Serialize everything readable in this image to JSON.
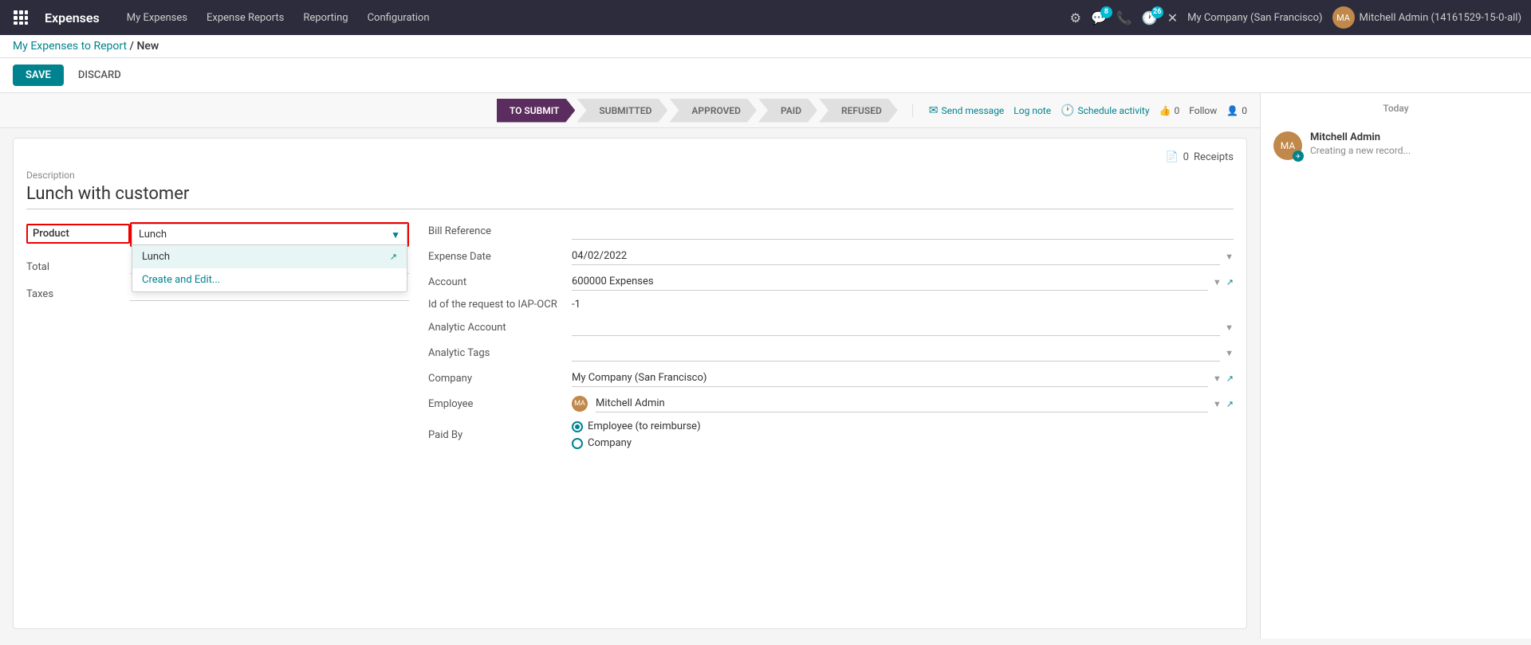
{
  "topnav": {
    "app_name": "Expenses",
    "menu_items": [
      "My Expenses",
      "Expense Reports",
      "Reporting",
      "Configuration"
    ],
    "company": "My Company (San Francisco)",
    "user": "Mitchell Admin (14161529-15-0-all)",
    "notifications_count": "8",
    "messages_count": "26"
  },
  "breadcrumb": {
    "parent": "My Expenses to Report",
    "separator": "/",
    "current": "New"
  },
  "actions": {
    "save": "SAVE",
    "discard": "DISCARD"
  },
  "status_steps": [
    "TO SUBMIT",
    "SUBMITTED",
    "APPROVED",
    "PAID",
    "REFUSED"
  ],
  "chatter_actions": {
    "send_message": "Send message",
    "log_note": "Log note",
    "schedule_activity": "Schedule activity",
    "followers_count": "0",
    "follow": "Follow",
    "likes_count": "0"
  },
  "form": {
    "description_label": "Description",
    "description_value": "Lunch with customer",
    "receipts_count": "0",
    "receipts_label": "Receipts",
    "left_fields": {
      "product_label": "Product",
      "product_value": "Lunch",
      "total_label": "Total",
      "taxes_label": "Taxes"
    },
    "dropdown_options": [
      "Lunch"
    ],
    "dropdown_create": "Create and Edit...",
    "right_fields": {
      "bill_reference_label": "Bill Reference",
      "bill_reference_value": "",
      "expense_date_label": "Expense Date",
      "expense_date_value": "04/02/2022",
      "account_label": "Account",
      "account_value": "600000 Expenses",
      "iap_ocr_label": "Id of the request to IAP-OCR",
      "iap_ocr_value": "-1",
      "analytic_account_label": "Analytic Account",
      "analytic_account_value": "",
      "analytic_tags_label": "Analytic Tags",
      "analytic_tags_value": "",
      "company_label": "Company",
      "company_value": "My Company (San Francisco)",
      "employee_label": "Employee",
      "employee_value": "Mitchell Admin",
      "paid_by_label": "Paid By",
      "paid_by_employee": "Employee (to reimburse)",
      "paid_by_company": "Company"
    }
  },
  "chatter": {
    "today_label": "Today",
    "message_author": "Mitchell Admin",
    "message_text": "Creating a new record..."
  }
}
